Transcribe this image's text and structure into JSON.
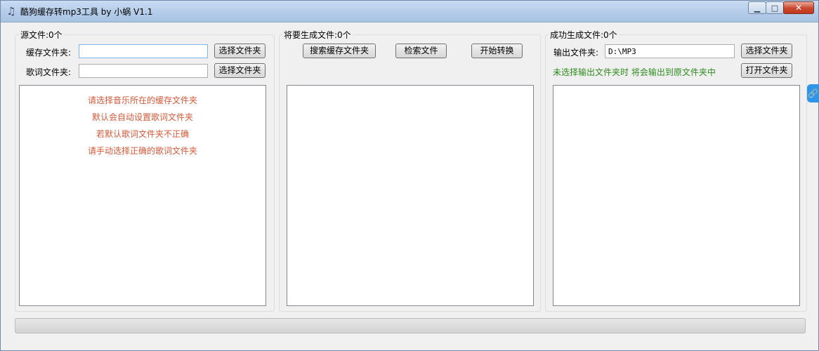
{
  "window": {
    "title": "酷狗缓存转mp3工具 by 小蜗 V1.1",
    "icon": "music-note-icon",
    "controls": {
      "minimize": "minimize-icon",
      "maximize": "maximize-icon",
      "close": "close-icon"
    }
  },
  "source": {
    "group_label": "源文件:0个",
    "cache_label": "缓存文件夹:",
    "cache_value": "",
    "lyrics_label": "歌词文件夹:",
    "lyrics_value": "",
    "choose_button": "选择文件夹",
    "hints": [
      "请选择音乐所在的缓存文件夹",
      "默认会自动设置歌词文件夹",
      "若默认歌词文件夹不正确",
      "请手动选择正确的歌词文件夹"
    ]
  },
  "pending": {
    "group_label": "将要生成文件:0个",
    "search_button": "搜索缓存文件夹",
    "retrieve_button": "检索文件",
    "convert_button": "开始转换"
  },
  "success": {
    "group_label": "成功生成文件:0个",
    "output_label": "输出文件夹:",
    "output_value": "D:\\MP3",
    "choose_button": "选择文件夹",
    "note": "未选择输出文件夹时 将会输出到原文件夹中",
    "open_button": "打开文件夹"
  },
  "progress": {
    "value": 0
  },
  "side_tab": {
    "icon": "link-icon"
  },
  "colors": {
    "hint": "#d05a3a",
    "note": "#2e8b1f",
    "side_tab": "#2e95e8"
  }
}
